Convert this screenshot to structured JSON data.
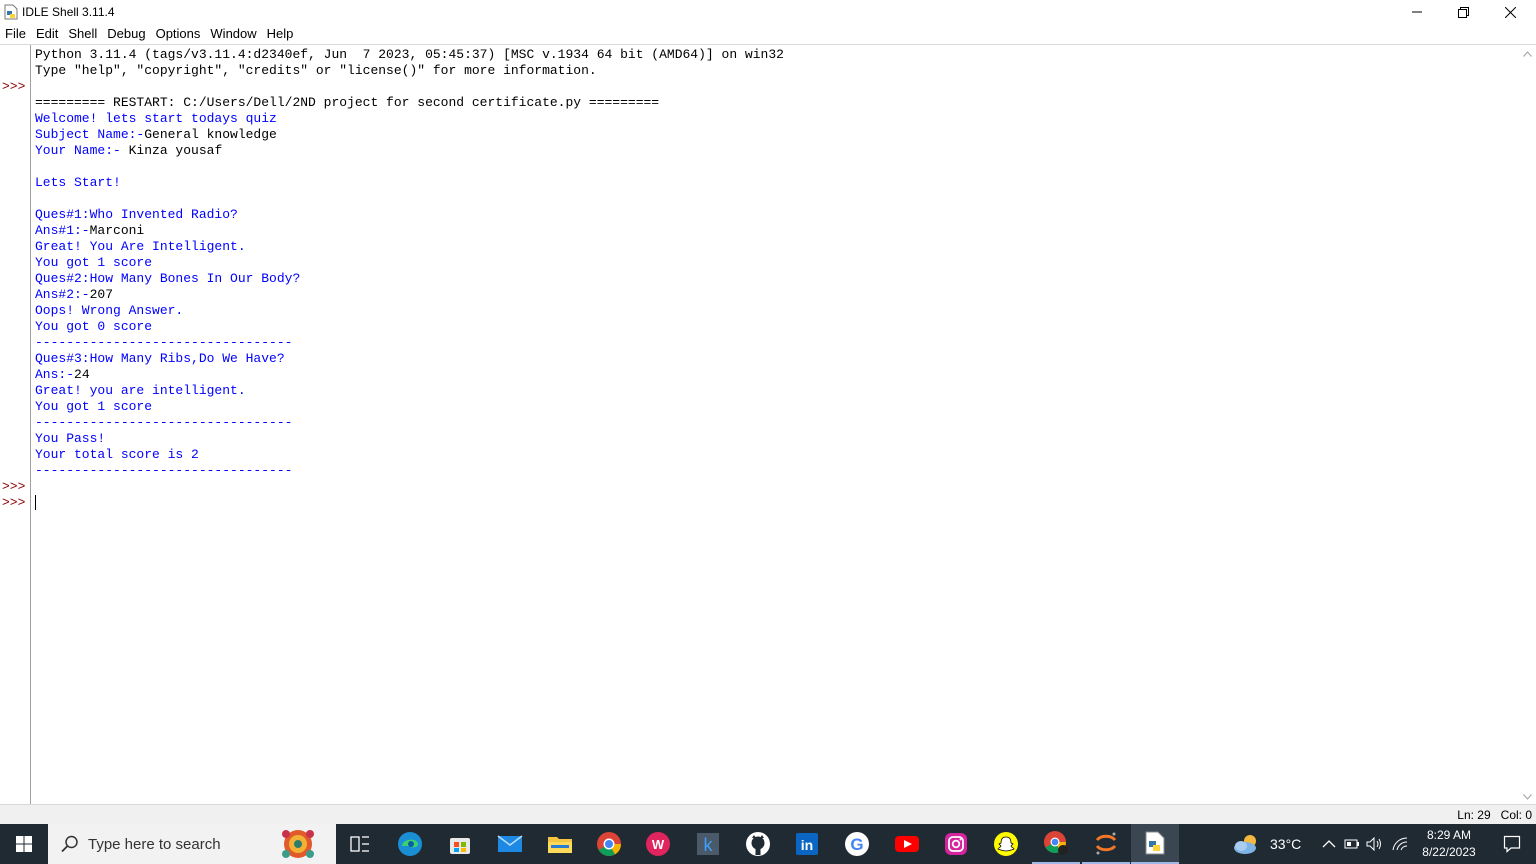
{
  "window": {
    "title": "IDLE Shell 3.11.4"
  },
  "menu": [
    "File",
    "Edit",
    "Shell",
    "Debug",
    "Options",
    "Window",
    "Help"
  ],
  "shell": {
    "prompt": ">>>",
    "lines": [
      {
        "text": "Python 3.11.4 (tags/v3.11.4:d2340ef, Jun  7 2023, 05:45:37) [MSC v.1934 64 bit (AMD64)] on win32",
        "kind": "in"
      },
      {
        "text": "Type \"help\", \"copyright\", \"credits\" or \"license()\" for more information.",
        "kind": "in"
      },
      {
        "text": "",
        "kind": "in"
      },
      {
        "text": "========= RESTART: C:/Users/Dell/2ND project for second certificate.py =========",
        "kind": "in"
      },
      {
        "text": "Welcome! lets start todays quiz",
        "kind": "out"
      },
      {
        "text": "Subject Name:-",
        "kind": "out",
        "input": "General knowledge"
      },
      {
        "text": "Your Name:- ",
        "kind": "out",
        "input": "Kinza yousaf"
      },
      {
        "text": "",
        "kind": "out"
      },
      {
        "text": "Lets Start!",
        "kind": "out"
      },
      {
        "text": "",
        "kind": "out"
      },
      {
        "text": "Ques#1:Who Invented Radio?",
        "kind": "out"
      },
      {
        "text": "Ans#1:-",
        "kind": "out",
        "input": "Marconi"
      },
      {
        "text": "Great! You Are Intelligent.",
        "kind": "out"
      },
      {
        "text": "You got 1 score",
        "kind": "out"
      },
      {
        "text": "Ques#2:How Many Bones In Our Body?",
        "kind": "out"
      },
      {
        "text": "Ans#2:-",
        "kind": "out",
        "input": "207"
      },
      {
        "text": "Oops! Wrong Answer.",
        "kind": "out"
      },
      {
        "text": "You got 0 score",
        "kind": "out"
      },
      {
        "text": "---------------------------------",
        "kind": "out"
      },
      {
        "text": "Ques#3:How Many Ribs,Do We Have?",
        "kind": "out"
      },
      {
        "text": "Ans:-",
        "kind": "out",
        "input": "24"
      },
      {
        "text": "Great! you are intelligent.",
        "kind": "out"
      },
      {
        "text": "You got 1 score",
        "kind": "out"
      },
      {
        "text": "---------------------------------",
        "kind": "out"
      },
      {
        "text": "You Pass!",
        "kind": "out"
      },
      {
        "text": "Your total score is 2",
        "kind": "out"
      },
      {
        "text": "---------------------------------",
        "kind": "out"
      }
    ]
  },
  "status": {
    "position": "Ln: 29   Col: 0"
  },
  "taskbar": {
    "search_placeholder": "Type here to search",
    "apps": [
      "task-view",
      "edge",
      "microsoft-store",
      "mail",
      "file-explorer",
      "chrome",
      "wps-office",
      "kotlin",
      "github",
      "linkedin",
      "google",
      "youtube",
      "instagram",
      "snapchat",
      "chrome-profile",
      "jupyter",
      "idle"
    ],
    "weather": "33°C",
    "time": "8:29 AM",
    "date": "8/22/2023"
  },
  "colors": {
    "output": "#0000ff",
    "prompt": "#8b0000",
    "taskbar": "#1f2a33"
  }
}
